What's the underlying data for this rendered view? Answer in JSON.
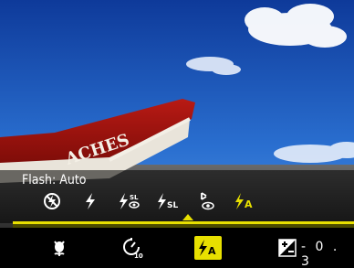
{
  "flash_panel": {
    "title": "Flash: Auto",
    "options": [
      {
        "icon": "flash-off-icon"
      },
      {
        "icon": "flash-on-icon"
      },
      {
        "icon": "slow-sync-red-eye-icon",
        "sub": "SL"
      },
      {
        "icon": "slow-sync-icon",
        "sub": "SL"
      },
      {
        "icon": "red-eye-reduction-icon"
      },
      {
        "icon": "flash-auto-icon",
        "sub": "A"
      }
    ],
    "selected": "Flash: Auto"
  },
  "toolbar": {
    "items": [
      {
        "icon": "macro-icon"
      },
      {
        "icon": "self-timer-icon",
        "sub": "10"
      },
      {
        "icon": "flash-auto-icon",
        "sub": "A"
      },
      {
        "icon": "exposure-compensation-icon"
      }
    ],
    "ev_value": "- 0 . 3"
  },
  "scene": {
    "boat_text": "ACHES"
  },
  "colors": {
    "accent": "#e8e000",
    "panel": "#000000"
  }
}
